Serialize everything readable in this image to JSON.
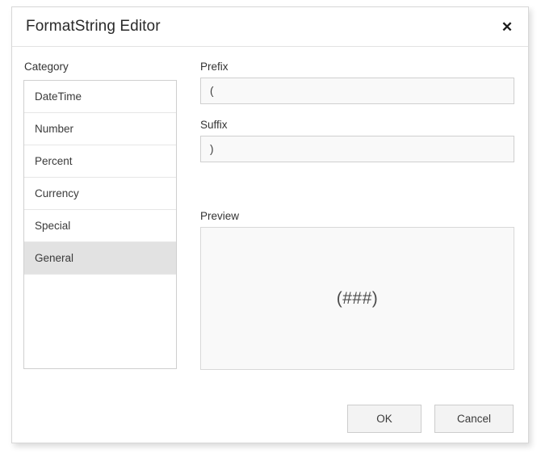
{
  "dialog": {
    "title": "FormatString Editor",
    "close_icon": "close-icon",
    "close_glyph": "✕"
  },
  "category": {
    "label": "Category",
    "items": [
      {
        "label": "DateTime",
        "selected": false
      },
      {
        "label": "Number",
        "selected": false
      },
      {
        "label": "Percent",
        "selected": false
      },
      {
        "label": "Currency",
        "selected": false
      },
      {
        "label": "Special",
        "selected": false
      },
      {
        "label": "General",
        "selected": true
      }
    ],
    "selected_value": "General"
  },
  "fields": {
    "prefix": {
      "label": "Prefix",
      "value": "(",
      "placeholder": ""
    },
    "suffix": {
      "label": "Suffix",
      "value": ")",
      "placeholder": ""
    }
  },
  "preview": {
    "label": "Preview",
    "text": "(###)"
  },
  "footer": {
    "ok_label": "OK",
    "cancel_label": "Cancel"
  },
  "colors": {
    "dialog_background": "#ffffff",
    "dialog_border": "#d7d7d7",
    "selected_row": "#e2e2e2",
    "input_background": "#f9f9f9",
    "input_border": "#cfcfcf",
    "button_background": "#f3f3f3",
    "text_primary": "#333333"
  }
}
